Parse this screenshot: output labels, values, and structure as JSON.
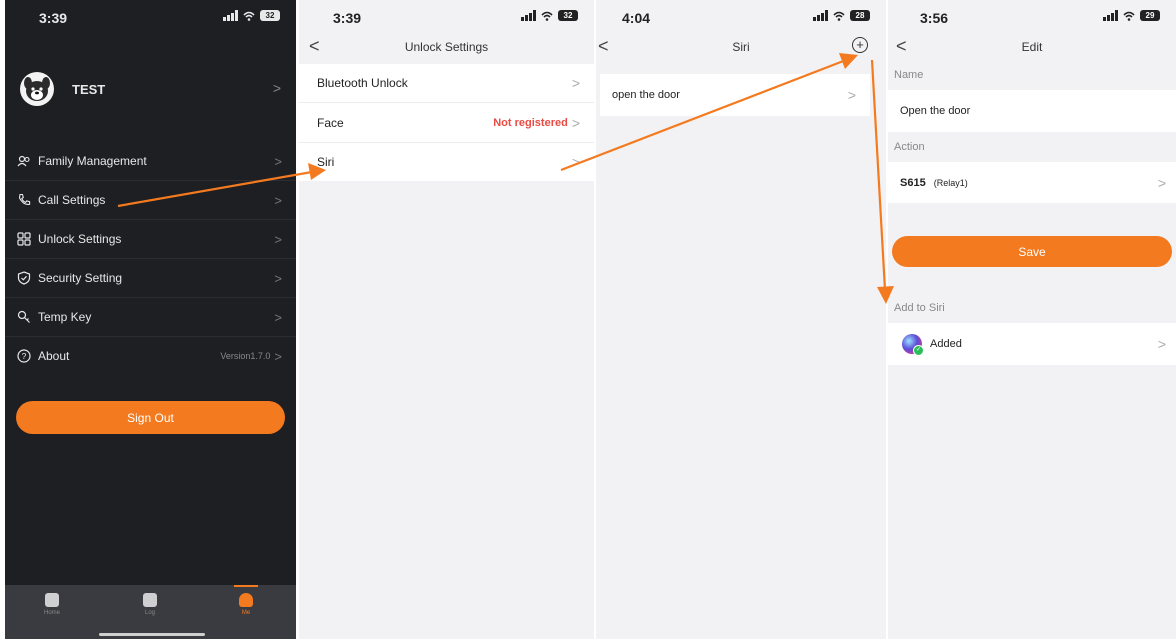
{
  "colors": {
    "accent": "#f47a20",
    "warning_text": "#e84b43",
    "dark_bg": "#1e1f23"
  },
  "screen1": {
    "status": {
      "time": "3:39",
      "battery": "32"
    },
    "user": {
      "name": "TEST"
    },
    "menu": [
      {
        "label": "Family Management",
        "icon": "family-icon"
      },
      {
        "label": "Call Settings",
        "icon": "phone-icon"
      },
      {
        "label": "Unlock Settings",
        "icon": "grid-icon"
      },
      {
        "label": "Security Setting",
        "icon": "shield-icon"
      },
      {
        "label": "Temp Key",
        "icon": "key-icon"
      },
      {
        "label": "About",
        "icon": "question-icon",
        "value": "Version1.7.0"
      }
    ],
    "sign_out": "Sign Out",
    "tabs": [
      {
        "label": "Home",
        "icon": "home-icon"
      },
      {
        "label": "Log",
        "icon": "log-icon"
      },
      {
        "label": "Me",
        "icon": "person-icon",
        "active": true
      }
    ]
  },
  "screen2": {
    "status": {
      "time": "3:39",
      "battery": "32"
    },
    "title": "Unlock  Settings",
    "rows": [
      {
        "label": "Bluetooth Unlock"
      },
      {
        "label": "Face",
        "value": "Not registered"
      },
      {
        "label": "Siri"
      }
    ]
  },
  "screen3": {
    "status": {
      "time": "4:04",
      "battery": "28"
    },
    "title": "Siri",
    "shortcuts": [
      {
        "label": "open the door"
      }
    ]
  },
  "screen4": {
    "status": {
      "time": "3:56",
      "battery": "29"
    },
    "title": "Edit",
    "name_label": "Name",
    "name_value": "Open the door",
    "action_label": "Action",
    "action_device": "S615",
    "action_relay": "(Relay1)",
    "save": "Save",
    "add_to_siri_label": "Add to Siri",
    "added": "Added"
  }
}
